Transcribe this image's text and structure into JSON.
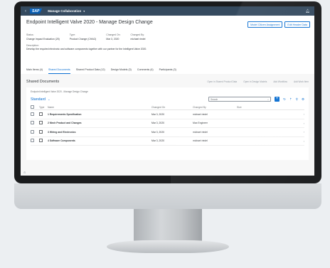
{
  "shell": {
    "back_icon": "chevron-left-icon",
    "logo": "SAP",
    "title": "Manage Collaboration",
    "caret": "▾",
    "bell_icon": "bell-icon"
  },
  "header": {
    "title": "Endpoint Intelligent Valve 2020 - Manage Design Change",
    "buttons": [
      "Model Citizen Assignment",
      "Edit Header Data"
    ],
    "attributes": [
      {
        "label": "Status:",
        "value": "Change Impact Evaluation (25)"
      },
      {
        "label": "Type:",
        "value": "Product Change (CHAG)"
      },
      {
        "label": "Changed On:",
        "value": "Mar 3, 2020"
      },
      {
        "label": "Changed By:",
        "value": "michael riedel"
      }
    ],
    "description": {
      "label": "Description:",
      "value": "Develop the required electronic and software components together with our partner for the Intelligent Valve 2020."
    }
  },
  "tabs": [
    {
      "label": "Main Items (4)",
      "active": false
    },
    {
      "label": "Shared Documents",
      "active": true
    },
    {
      "label": "Shared Product Data (12)",
      "active": false
    },
    {
      "label": "Design Models (3)",
      "active": false
    },
    {
      "label": "Comments (4)",
      "active": false
    },
    {
      "label": "Participants (3)",
      "active": false
    }
  ],
  "section": {
    "title": "Shared Documents",
    "actions": [
      "Open in Shared Product Data",
      "Open in Design Models",
      "Add Workflow",
      "Add Work Item"
    ]
  },
  "panel": {
    "breadcrumb": "Endpoint Intelligent Valve 2020 - Manage Design Change",
    "variant": "Standard",
    "search_placeholder": "Search",
    "search_icon": "search-icon",
    "add_label": "+",
    "tool_icons": [
      "refresh-icon",
      "upload-icon",
      "link-icon",
      "settings-icon"
    ]
  },
  "grid": {
    "headers": {
      "type": "Type",
      "name": "Name",
      "changed_on": "Changed On",
      "changed_by": "Changed By",
      "size": "Size"
    },
    "rows": [
      {
        "name": "1 Requirements Specification",
        "changed_on": "Mar 3, 2020",
        "changed_by": "michael riedel",
        "size": ""
      },
      {
        "name": "2 Mech Product and Changes",
        "changed_on": "Mar 3, 2020",
        "changed_by": "Max Engineer",
        "size": ""
      },
      {
        "name": "3 Wiring and Electronics",
        "changed_on": "Mar 3, 2020",
        "changed_by": "michael riedel",
        "size": ""
      },
      {
        "name": "4 Software Components",
        "changed_on": "Mar 3, 2020",
        "changed_by": "michael riedel",
        "size": ""
      }
    ]
  },
  "colors": {
    "shell": "#354a5f",
    "accent": "#0a6ed1",
    "text": "#32363a"
  }
}
